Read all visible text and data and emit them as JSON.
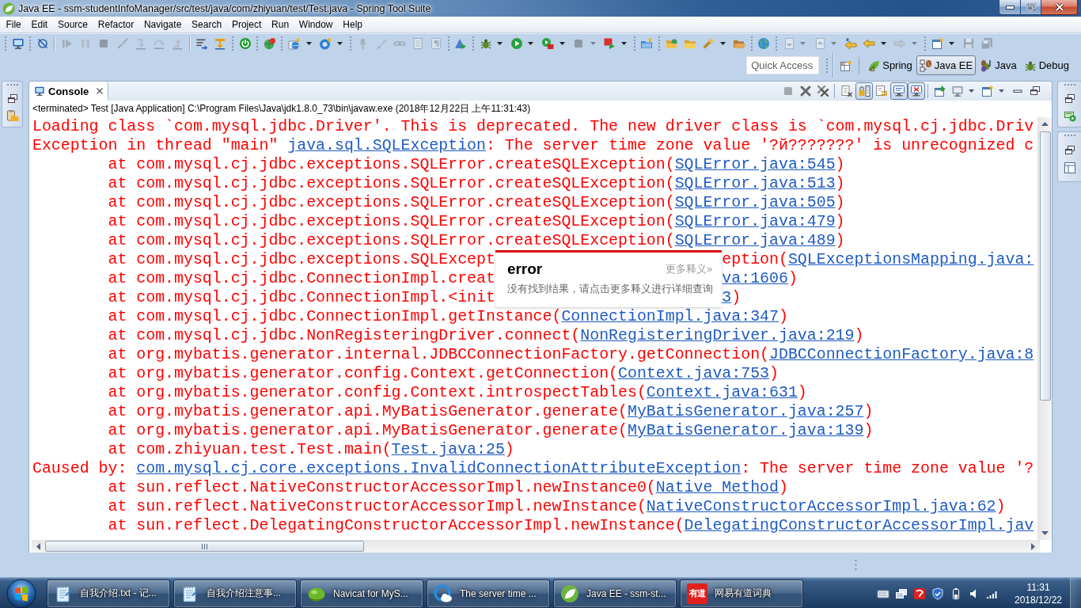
{
  "window": {
    "title": "Java EE - ssm-studentInfoManager/src/test/java/com/zhiyuan/test/Test.java - Spring Tool Suite"
  },
  "menu": [
    "File",
    "Edit",
    "Source",
    "Refactor",
    "Navigate",
    "Search",
    "Project",
    "Run",
    "Window",
    "Help"
  ],
  "toolbar": [
    {
      "kind": "grip"
    },
    {
      "kind": "monitor",
      "disabled": false,
      "dropdown": false
    },
    {
      "kind": "grip"
    },
    {
      "kind": "skip",
      "disabled": false,
      "dropdown": false
    },
    {
      "kind": "line"
    },
    {
      "kind": "resume",
      "disabled": true,
      "dropdown": false
    },
    {
      "kind": "suspend",
      "disabled": true,
      "dropdown": false
    },
    {
      "kind": "terminate",
      "disabled": true,
      "dropdown": false
    },
    {
      "kind": "disconnect",
      "disabled": true,
      "dropdown": false
    },
    {
      "kind": "step_into",
      "disabled": true,
      "dropdown": false
    },
    {
      "kind": "step_over",
      "disabled": true,
      "dropdown": false
    },
    {
      "kind": "step_return",
      "disabled": true,
      "dropdown": false
    },
    {
      "kind": "line"
    },
    {
      "kind": "filters",
      "disabled": false,
      "dropdown": false
    },
    {
      "kind": "drop_frame",
      "disabled": false,
      "dropdown": false
    },
    {
      "kind": "grip"
    },
    {
      "kind": "power",
      "disabled": false,
      "dropdown": false
    },
    {
      "kind": "grip"
    },
    {
      "kind": "globe_badge",
      "disabled": false,
      "dropdown": false
    },
    {
      "kind": "grip"
    },
    {
      "kind": "globe_star",
      "disabled": false,
      "dropdown": true
    },
    {
      "kind": "circle_plus",
      "disabled": false,
      "dropdown": true
    },
    {
      "kind": "grip"
    },
    {
      "kind": "pin",
      "disabled": true,
      "dropdown": false
    },
    {
      "kind": "brush",
      "disabled": true,
      "dropdown": false
    },
    {
      "kind": "chain",
      "disabled": true,
      "dropdown": false
    },
    {
      "kind": "page",
      "disabled": true,
      "dropdown": false
    },
    {
      "kind": "pilcrow",
      "disabled": true,
      "dropdown": false
    },
    {
      "kind": "grip"
    },
    {
      "kind": "tool_play",
      "disabled": false,
      "dropdown": false
    },
    {
      "kind": "grip"
    },
    {
      "kind": "bug",
      "disabled": false,
      "dropdown": true
    },
    {
      "kind": "play_circle",
      "disabled": false,
      "dropdown": true
    },
    {
      "kind": "play_badge",
      "disabled": false,
      "dropdown": true
    },
    {
      "kind": "terminate",
      "disabled": true,
      "dropdown": true
    },
    {
      "kind": "box_play",
      "disabled": false,
      "dropdown": true
    },
    {
      "kind": "grip"
    },
    {
      "kind": "folder_sparkle",
      "disabled": false,
      "dropdown": false
    },
    {
      "kind": "grip"
    },
    {
      "kind": "folder_globe",
      "disabled": false,
      "dropdown": false
    },
    {
      "kind": "folder",
      "disabled": false,
      "dropdown": false
    },
    {
      "kind": "flashlight",
      "disabled": false,
      "dropdown": true
    },
    {
      "kind": "folder_open",
      "disabled": false,
      "dropdown": false
    },
    {
      "kind": "grip"
    },
    {
      "kind": "globe",
      "disabled": false,
      "dropdown": false
    },
    {
      "kind": "grip"
    },
    {
      "kind": "page_down",
      "disabled": true,
      "dropdown": true
    },
    {
      "kind": "page_up",
      "disabled": true,
      "dropdown": true
    },
    {
      "kind": "star_back",
      "disabled": false,
      "dropdown": false
    },
    {
      "kind": "back",
      "disabled": false,
      "dropdown": true
    },
    {
      "kind": "forward",
      "disabled": true,
      "dropdown": true
    },
    {
      "kind": "grip"
    },
    {
      "kind": "new_window",
      "disabled": false,
      "dropdown": true
    },
    {
      "kind": "save",
      "disabled": true,
      "dropdown": false
    },
    {
      "kind": "save_all",
      "disabled": true,
      "dropdown": false
    }
  ],
  "quick_access": {
    "placeholder": "Quick Access"
  },
  "perspectives": [
    {
      "kind": "spring",
      "label": "Spring",
      "selected": false
    },
    {
      "kind": "javaee",
      "label": "Java EE",
      "selected": true
    },
    {
      "kind": "java",
      "label": "Java",
      "selected": false
    },
    {
      "kind": "debug",
      "label": "Debug",
      "selected": false
    }
  ],
  "console": {
    "tab": "Console",
    "description": "<terminated> Test [Java Application] C:\\Program Files\\Java\\jdk1.8.0_73\\bin\\javaw.exe (2018年12月22日 上午11:31:43)",
    "toolbar": [
      {
        "kind": "terminate",
        "disabled": true,
        "checked": false,
        "dropdown": false
      },
      {
        "kind": "remove",
        "disabled": false,
        "checked": false,
        "dropdown": false
      },
      {
        "kind": "remove_all",
        "disabled": false,
        "checked": false,
        "dropdown": false
      },
      {
        "kind": "line"
      },
      {
        "kind": "clear",
        "disabled": false,
        "checked": false,
        "dropdown": false
      },
      {
        "kind": "scroll_lock",
        "disabled": false,
        "checked": true,
        "dropdown": false
      },
      {
        "kind": "word_wrap",
        "disabled": false,
        "checked": false,
        "dropdown": false
      },
      {
        "kind": "stdout",
        "disabled": false,
        "checked": true,
        "dropdown": false
      },
      {
        "kind": "stderr",
        "disabled": false,
        "checked": true,
        "dropdown": false
      },
      {
        "kind": "line"
      },
      {
        "kind": "pin_window",
        "disabled": false,
        "checked": false,
        "dropdown": false
      },
      {
        "kind": "display_console",
        "disabled": false,
        "checked": false,
        "dropdown": true
      },
      {
        "kind": "open_console",
        "disabled": false,
        "checked": false,
        "dropdown": true
      },
      {
        "kind": "minimize",
        "disabled": false,
        "checked": false,
        "dropdown": false
      },
      {
        "kind": "maximize",
        "disabled": false,
        "checked": false,
        "dropdown": false
      }
    ],
    "lines": [
      {
        "kind": "message",
        "parts": [
          {
            "kind": "text",
            "text": "Loading class `com.mysql.jdbc.Driver'. This is deprecated. The new driver class is `com.mysql.cj.jdbc.Driv"
          }
        ]
      },
      {
        "kind": "message",
        "parts": [
          {
            "kind": "text",
            "text": "Exception in thread \"main\" "
          },
          {
            "kind": "link",
            "text": "java.sql.SQLException"
          },
          {
            "kind": "text",
            "text": ": The server time zone value '?й???????' is unrecognized c"
          }
        ]
      },
      {
        "kind": "frame",
        "parts": [
          {
            "kind": "text",
            "text": "at com.mysql.cj.jdbc.exceptions.SQLError.createSQLException("
          },
          {
            "kind": "link",
            "text": "SQLError.java:545"
          },
          {
            "kind": "text",
            "text": ")"
          }
        ]
      },
      {
        "kind": "frame",
        "parts": [
          {
            "kind": "text",
            "text": "at com.mysql.cj.jdbc.exceptions.SQLError.createSQLException("
          },
          {
            "kind": "link",
            "text": "SQLError.java:513"
          },
          {
            "kind": "text",
            "text": ")"
          }
        ]
      },
      {
        "kind": "frame",
        "parts": [
          {
            "kind": "text",
            "text": "at com.mysql.cj.jdbc.exceptions.SQLError.createSQLException("
          },
          {
            "kind": "link",
            "text": "SQLError.java:505"
          },
          {
            "kind": "text",
            "text": ")"
          }
        ]
      },
      {
        "kind": "frame",
        "parts": [
          {
            "kind": "text",
            "text": "at com.mysql.cj.jdbc.exceptions.SQLError.createSQLException("
          },
          {
            "kind": "link",
            "text": "SQLError.java:479"
          },
          {
            "kind": "text",
            "text": ")"
          }
        ]
      },
      {
        "kind": "frame",
        "parts": [
          {
            "kind": "text",
            "text": "at com.mysql.cj.jdbc.exceptions.SQLError.createSQLException("
          },
          {
            "kind": "link",
            "text": "SQLError.java:489"
          },
          {
            "kind": "text",
            "text": ")"
          }
        ]
      },
      {
        "kind": "frame",
        "parts": [
          {
            "kind": "text",
            "text": "at com.mysql.cj.jdbc.exceptions.SQLExcept"
          },
          {
            "kind": "covered"
          },
          {
            "kind": "text",
            "text": "eption("
          },
          {
            "kind": "link",
            "text": "SQLExceptionsMapping.java:"
          }
        ]
      },
      {
        "kind": "frame",
        "parts": [
          {
            "kind": "text",
            "text": "at com.mysql.cj.jdbc.ConnectionImpl.creat"
          },
          {
            "kind": "covered"
          },
          {
            "kind": "link",
            "text": "va:1606"
          },
          {
            "kind": "text",
            "text": ")"
          }
        ]
      },
      {
        "kind": "frame",
        "parts": [
          {
            "kind": "text",
            "text": "at com.mysql.cj.jdbc.ConnectionImpl.<init"
          },
          {
            "kind": "covered"
          },
          {
            "kind": "link",
            "text": "3"
          },
          {
            "kind": "text",
            "text": ")"
          }
        ]
      },
      {
        "kind": "frame",
        "parts": [
          {
            "kind": "text",
            "text": "at com.mysql.cj.jdbc.ConnectionImpl.getInstance("
          },
          {
            "kind": "link",
            "text": "ConnectionImpl.java:347"
          },
          {
            "kind": "text",
            "text": ")"
          }
        ]
      },
      {
        "kind": "frame",
        "parts": [
          {
            "kind": "text",
            "text": "at com.mysql.cj.jdbc.NonRegisteringDriver.connect("
          },
          {
            "kind": "link",
            "text": "NonRegisteringDriver.java:219"
          },
          {
            "kind": "text",
            "text": ")"
          }
        ]
      },
      {
        "kind": "frame",
        "parts": [
          {
            "kind": "text",
            "text": "at org.mybatis.generator.internal.JDBCConnectionFactory.getConnection("
          },
          {
            "kind": "link",
            "text": "JDBCConnectionFactory.java:8"
          }
        ]
      },
      {
        "kind": "frame",
        "parts": [
          {
            "kind": "text",
            "text": "at org.mybatis.generator.config.Context.getConnection("
          },
          {
            "kind": "link",
            "text": "Context.java:753"
          },
          {
            "kind": "text",
            "text": ")"
          }
        ]
      },
      {
        "kind": "frame",
        "parts": [
          {
            "kind": "text",
            "text": "at org.mybatis.generator.config.Context.introspectTables("
          },
          {
            "kind": "link",
            "text": "Context.java:631"
          },
          {
            "kind": "text",
            "text": ")"
          }
        ]
      },
      {
        "kind": "frame",
        "parts": [
          {
            "kind": "text",
            "text": "at org.mybatis.generator.api.MyBatisGenerator.generate("
          },
          {
            "kind": "link",
            "text": "MyBatisGenerator.java:257"
          },
          {
            "kind": "text",
            "text": ")"
          }
        ]
      },
      {
        "kind": "frame",
        "parts": [
          {
            "kind": "text",
            "text": "at org.mybatis.generator.api.MyBatisGenerator.generate("
          },
          {
            "kind": "link",
            "text": "MyBatisGenerator.java:139"
          },
          {
            "kind": "text",
            "text": ")"
          }
        ]
      },
      {
        "kind": "frame",
        "parts": [
          {
            "kind": "text",
            "text": "at com.zhiyuan.test.Test.main("
          },
          {
            "kind": "link",
            "text": "Test.java:25"
          },
          {
            "kind": "text",
            "text": ")"
          }
        ]
      },
      {
        "kind": "message",
        "parts": [
          {
            "kind": "text",
            "text": "Caused by: "
          },
          {
            "kind": "link",
            "text": "com.mysql.cj.core.exceptions.InvalidConnectionAttributeException"
          },
          {
            "kind": "text",
            "text": ": The server time zone value '?"
          }
        ]
      },
      {
        "kind": "frame",
        "parts": [
          {
            "kind": "text",
            "text": "at sun.reflect.NativeConstructorAccessorImpl.newInstance0("
          },
          {
            "kind": "link",
            "text": "Native Method"
          },
          {
            "kind": "text",
            "text": ")"
          }
        ]
      },
      {
        "kind": "frame",
        "parts": [
          {
            "kind": "text",
            "text": "at sun.reflect.NativeConstructorAccessorImpl.newInstance("
          },
          {
            "kind": "link",
            "text": "NativeConstructorAccessorImpl.java:62"
          },
          {
            "kind": "text",
            "text": ")"
          }
        ]
      },
      {
        "kind": "frame",
        "parts": [
          {
            "kind": "text",
            "text": "at sun.reflect.DelegatingConstructorAccessorImpl.newInstance("
          },
          {
            "kind": "link",
            "text": "DelegatingConstructorAccessorImpl.jav"
          }
        ]
      }
    ]
  },
  "popup": {
    "word": "error",
    "more": "更多释义»",
    "message": "没有找到结果，请点击更多释义进行详细查询"
  },
  "taskbar": {
    "buttons": [
      {
        "kind": "notepad",
        "label": "自我介绍.txt - 记..."
      },
      {
        "kind": "notepad",
        "label": "自我介绍注意事..."
      },
      {
        "kind": "blob",
        "label": "Navicat for MyS..."
      },
      {
        "kind": "ring",
        "label": "The server time ..."
      },
      {
        "kind": "leaf",
        "label": "Java EE - ssm-st..."
      },
      {
        "kind": "logo",
        "logo": "有道",
        "label": "网易有道词典"
      }
    ],
    "clock": {
      "time": "11:31",
      "date": "2018/12/22"
    }
  }
}
